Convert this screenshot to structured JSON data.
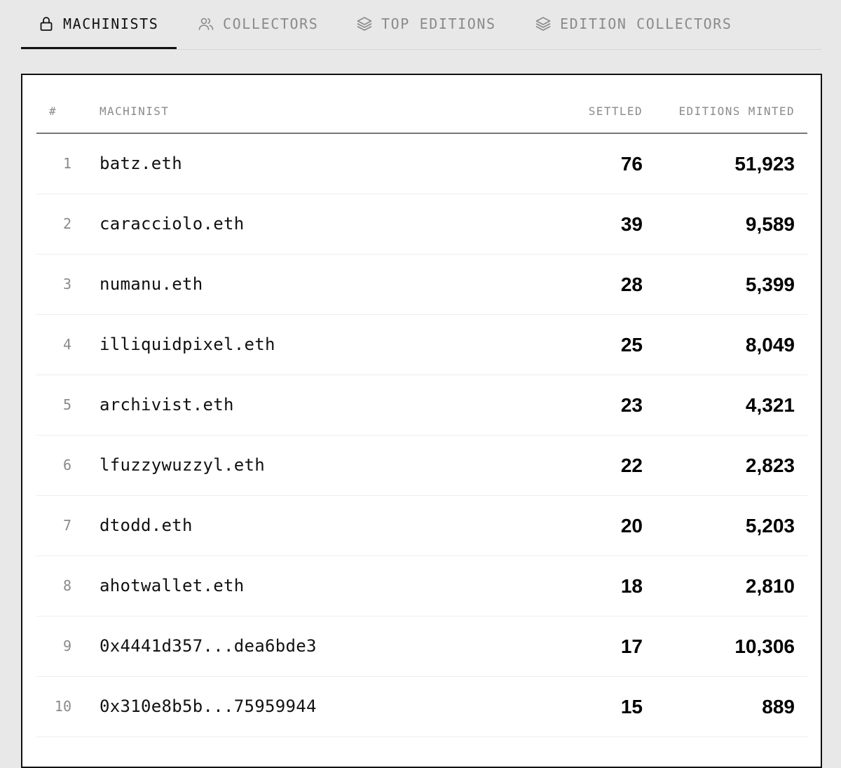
{
  "tabs": [
    {
      "label": "MACHINISTS",
      "icon": "lock-icon",
      "active": true
    },
    {
      "label": "COLLECTORS",
      "icon": "users-icon",
      "active": false
    },
    {
      "label": "TOP EDITIONS",
      "icon": "layers-icon",
      "active": false
    },
    {
      "label": "EDITION COLLECTORS",
      "icon": "layers-icon",
      "active": false
    }
  ],
  "table": {
    "headers": {
      "rank": "#",
      "name": "MACHINIST",
      "settled": "SETTLED",
      "editions": "EDITIONS MINTED"
    },
    "rows": [
      {
        "rank": "1",
        "name": "batz.eth",
        "settled": "76",
        "editions": "51,923"
      },
      {
        "rank": "2",
        "name": "caracciolo.eth",
        "settled": "39",
        "editions": "9,589"
      },
      {
        "rank": "3",
        "name": "numanu.eth",
        "settled": "28",
        "editions": "5,399"
      },
      {
        "rank": "4",
        "name": "illiquidpixel.eth",
        "settled": "25",
        "editions": "8,049"
      },
      {
        "rank": "5",
        "name": "archivist.eth",
        "settled": "23",
        "editions": "4,321"
      },
      {
        "rank": "6",
        "name": "lfuzzywuzzyl.eth",
        "settled": "22",
        "editions": "2,823"
      },
      {
        "rank": "7",
        "name": "dtodd.eth",
        "settled": "20",
        "editions": "5,203"
      },
      {
        "rank": "8",
        "name": "ahotwallet.eth",
        "settled": "18",
        "editions": "2,810"
      },
      {
        "rank": "9",
        "name": "0x4441d357...dea6bde3",
        "settled": "17",
        "editions": "10,306"
      },
      {
        "rank": "10",
        "name": "0x310e8b5b...75959944",
        "settled": "15",
        "editions": "889"
      }
    ]
  },
  "colors": {
    "background": "#e8e8e8",
    "panel": "#ffffff",
    "text": "#111111",
    "muted": "#8a8a8a"
  }
}
